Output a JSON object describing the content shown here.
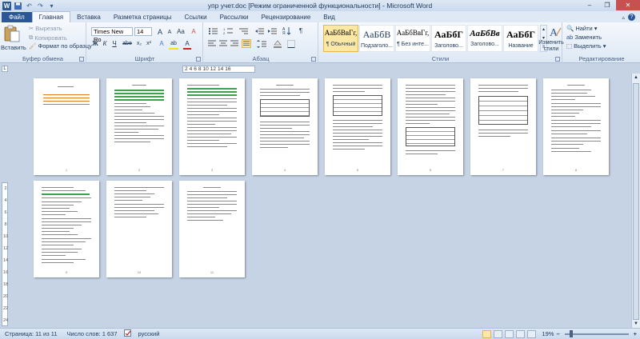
{
  "title": "упр учет.doc [Режим ограниченной функциональности] - Microsoft Word",
  "app_logo": "W",
  "tabs": [
    "Файл",
    "Главная",
    "Вставка",
    "Разметка страницы",
    "Ссылки",
    "Рассылки",
    "Рецензирование",
    "Вид"
  ],
  "clipboard": {
    "paste": "Вставить",
    "cut": "Вырезать",
    "copy": "Копировать",
    "format_painter": "Формат по образцу",
    "label": "Буфер обмена"
  },
  "font": {
    "name": "Times New Ro",
    "size": "14",
    "label": "Шрифт",
    "bold": "Ж",
    "italic": "К",
    "underline": "Ч",
    "strike": "abe",
    "sub": "x₂",
    "sup": "x²",
    "grow": "A",
    "shrink": "A",
    "case": "Aa",
    "clear": "A",
    "effects": "A",
    "highlight": "ab",
    "color": "A"
  },
  "paragraph": {
    "label": "Абзац",
    "pilcrow": "¶"
  },
  "styles": {
    "label": "Стили",
    "items": [
      {
        "sample": "АаБбВвГг,",
        "name": "¶ Обычный",
        "active": true
      },
      {
        "sample": "АаБбВ",
        "name": "Подзаголо...",
        "active": false
      },
      {
        "sample": "АаБбВвГг,",
        "name": "¶ Без инте...",
        "active": false
      },
      {
        "sample": "АаБбГ",
        "name": "Заголово...",
        "active": false
      },
      {
        "sample": "АаБбВв",
        "name": "Заголово...",
        "active": false
      },
      {
        "sample": "АаБбГ",
        "name": "Название",
        "active": false
      }
    ],
    "change_styles": "Изменить стили"
  },
  "editing": {
    "label": "Редактирование",
    "find": "Найти",
    "replace": "Заменить",
    "select": "Выделить"
  },
  "ruler": {
    "marks": [
      "2",
      "4",
      "6",
      "8",
      "10",
      "12",
      "14",
      "16"
    ]
  },
  "vruler_marks": [
    "2",
    "4",
    "6",
    "8",
    "10",
    "12",
    "14",
    "16",
    "18",
    "20",
    "22",
    "24"
  ],
  "pages": {
    "numbers": [
      "1",
      "2",
      "3",
      "4",
      "5",
      "6",
      "7",
      "8",
      "9",
      "10",
      "11"
    ]
  },
  "status": {
    "page": "Страница: 11 из 11",
    "words": "Число слов: 1 637",
    "language": "русский",
    "zoom": "19%"
  },
  "colors": {
    "accent": "#2b5797",
    "background": "#c5d3e4",
    "highlight_green": "#3ba24b",
    "highlight_orange": "#e07b1c",
    "active_style": "#fde8a6"
  }
}
